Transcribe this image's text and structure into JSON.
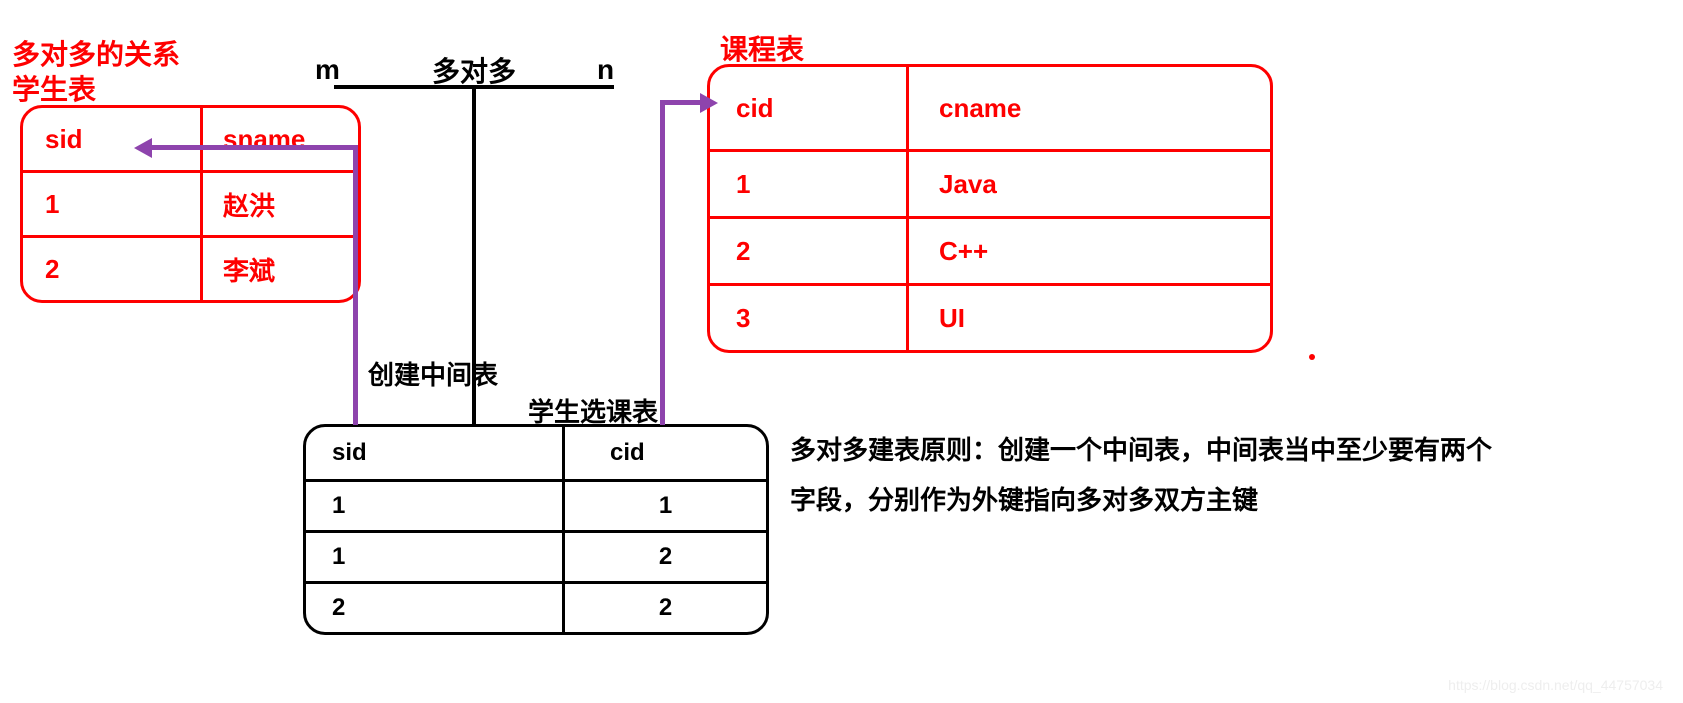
{
  "title_rel": "多对多的关系",
  "student": {
    "name": "学生表",
    "headers": {
      "sid": "sid",
      "sname": "sname"
    },
    "rows": [
      {
        "sid": "1",
        "sname": "赵洪"
      },
      {
        "sid": "2",
        "sname": "李斌"
      }
    ]
  },
  "course": {
    "name": "课程表",
    "headers": {
      "cid": "cid",
      "cname": "cname"
    },
    "rows": [
      {
        "cid": "1",
        "cname": "Java"
      },
      {
        "cid": "2",
        "cname": "C++"
      },
      {
        "cid": "3",
        "cname": "UI"
      }
    ]
  },
  "junction": {
    "create_label": "创建中间表",
    "name": "学生选课表",
    "headers": {
      "sid": "sid",
      "cid": "cid"
    },
    "rows": [
      {
        "sid": "1",
        "cid": "1"
      },
      {
        "sid": "1",
        "cid": "2"
      },
      {
        "sid": "2",
        "cid": "2"
      }
    ]
  },
  "relation": {
    "left": "m",
    "label": "多对多",
    "right": "n"
  },
  "principle": "多对多建表原则：创建一个中间表，中间表当中至少要有两个\n字段，分别作为外键指向多对多双方主键",
  "watermark": "https://blog.csdn.net/qq_44757034"
}
